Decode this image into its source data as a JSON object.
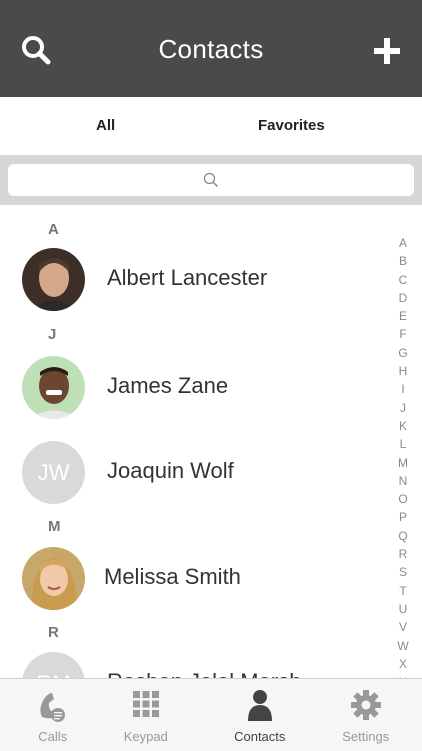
{
  "header": {
    "title": "Contacts",
    "search_icon": "search-icon",
    "add_icon": "plus-icon"
  },
  "tabs": [
    {
      "label": "All"
    },
    {
      "label": "Favorites"
    }
  ],
  "search": {
    "placeholder": ""
  },
  "sections": [
    {
      "letter": "A"
    },
    {
      "letter": "J"
    },
    {
      "letter": "M"
    },
    {
      "letter": "R"
    }
  ],
  "contacts": [
    {
      "name": "Albert Lancester",
      "avatar": "photo"
    },
    {
      "name": "James Zane",
      "avatar": "photo"
    },
    {
      "name": "Joaquin Wolf",
      "avatar": "initials",
      "initials": "JW"
    },
    {
      "name": "Melissa Smith",
      "avatar": "photo"
    },
    {
      "name": "Roshan Jalal Marsh",
      "avatar": "initials",
      "initials": "RM"
    }
  ],
  "index_letters": [
    "A",
    "B",
    "C",
    "D",
    "E",
    "F",
    "G",
    "H",
    "I",
    "J",
    "K",
    "L",
    "M",
    "N",
    "O",
    "P",
    "Q",
    "R",
    "S",
    "T",
    "U",
    "V",
    "W",
    "X",
    "Y"
  ],
  "tabbar": [
    {
      "label": "Calls",
      "icon": "phone-icon"
    },
    {
      "label": "Keypad",
      "icon": "keypad-icon"
    },
    {
      "label": "Contacts",
      "icon": "person-icon"
    },
    {
      "label": "Settings",
      "icon": "gear-icon"
    }
  ],
  "colors": {
    "header_bg": "#4a4a4a",
    "search_bg": "#d6d6d9",
    "tabbar_bg": "#f6f6f6",
    "active_tab": "#444444",
    "inactive_tab": "#999999"
  }
}
